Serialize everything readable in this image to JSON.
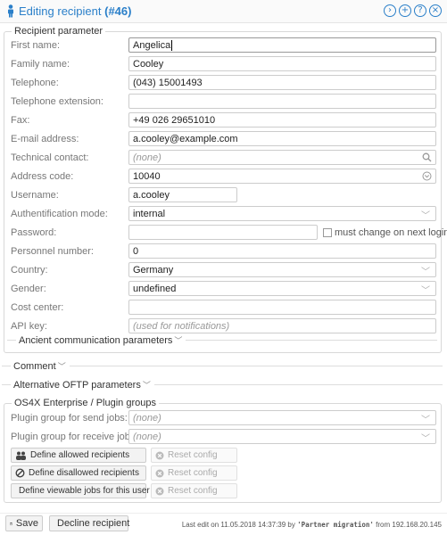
{
  "header": {
    "title": "Editing recipient",
    "id_label": "(#46)",
    "icons": [
      "chevron-right-circle-icon",
      "plus-circle-icon",
      "help-circle-icon",
      "close-circle-icon"
    ],
    "accent_color": "#2a7fc9"
  },
  "recipient": {
    "legend": "Recipient parameter",
    "fields": [
      {
        "label": "First name:",
        "value": "Angelica"
      },
      {
        "label": "Family name:",
        "value": "Cooley"
      },
      {
        "label": "Telephone:",
        "value": "(043) 15001493"
      },
      {
        "label": "Telephone extension:",
        "value": ""
      },
      {
        "label": "Fax:",
        "value": "+49 026 29651010"
      },
      {
        "label": "E-mail address:",
        "value": "a.cooley@example.com"
      },
      {
        "label": "Technical contact:",
        "placeholder": "(none)"
      },
      {
        "label": "Address code:",
        "value": "10040"
      },
      {
        "label": "Username:",
        "value": "a.cooley"
      },
      {
        "label": "Authentification mode:",
        "value": "internal"
      },
      {
        "label": "Password:",
        "value": ""
      },
      {
        "label": "Personnel number:",
        "value": "0"
      },
      {
        "label": "Country:",
        "value": "Germany"
      },
      {
        "label": "Gender:",
        "value": "undefined"
      },
      {
        "label": "Cost center:",
        "value": ""
      },
      {
        "label": "API key:",
        "placeholder": "(used for notifications)"
      }
    ],
    "must_change_label": "must change on next login",
    "ancient_label": "Ancient communication parameters"
  },
  "sections": {
    "comment": "Comment",
    "oftp": "Alternative OFTP parameters"
  },
  "os4x": {
    "legend": "OS4X Enterprise / Plugin groups",
    "send_label": "Plugin group for send jobs:",
    "send_placeholder": "(none)",
    "receive_label": "Plugin group for receive jobs:",
    "receive_placeholder": "(none)",
    "buttons": [
      {
        "label": "Define allowed recipients",
        "reset": "Reset config"
      },
      {
        "label": "Define disallowed recipients",
        "reset": "Reset config"
      },
      {
        "label": "Define viewable jobs for this user",
        "reset": "Reset config"
      }
    ]
  },
  "footer": {
    "save": "Save",
    "decline": "Decline recipient",
    "info_prefix": "Last edit on 11.05.2018 14:37:39 by",
    "info_user": "'Partner migration'",
    "info_suffix": "from 192.168.20.145"
  }
}
